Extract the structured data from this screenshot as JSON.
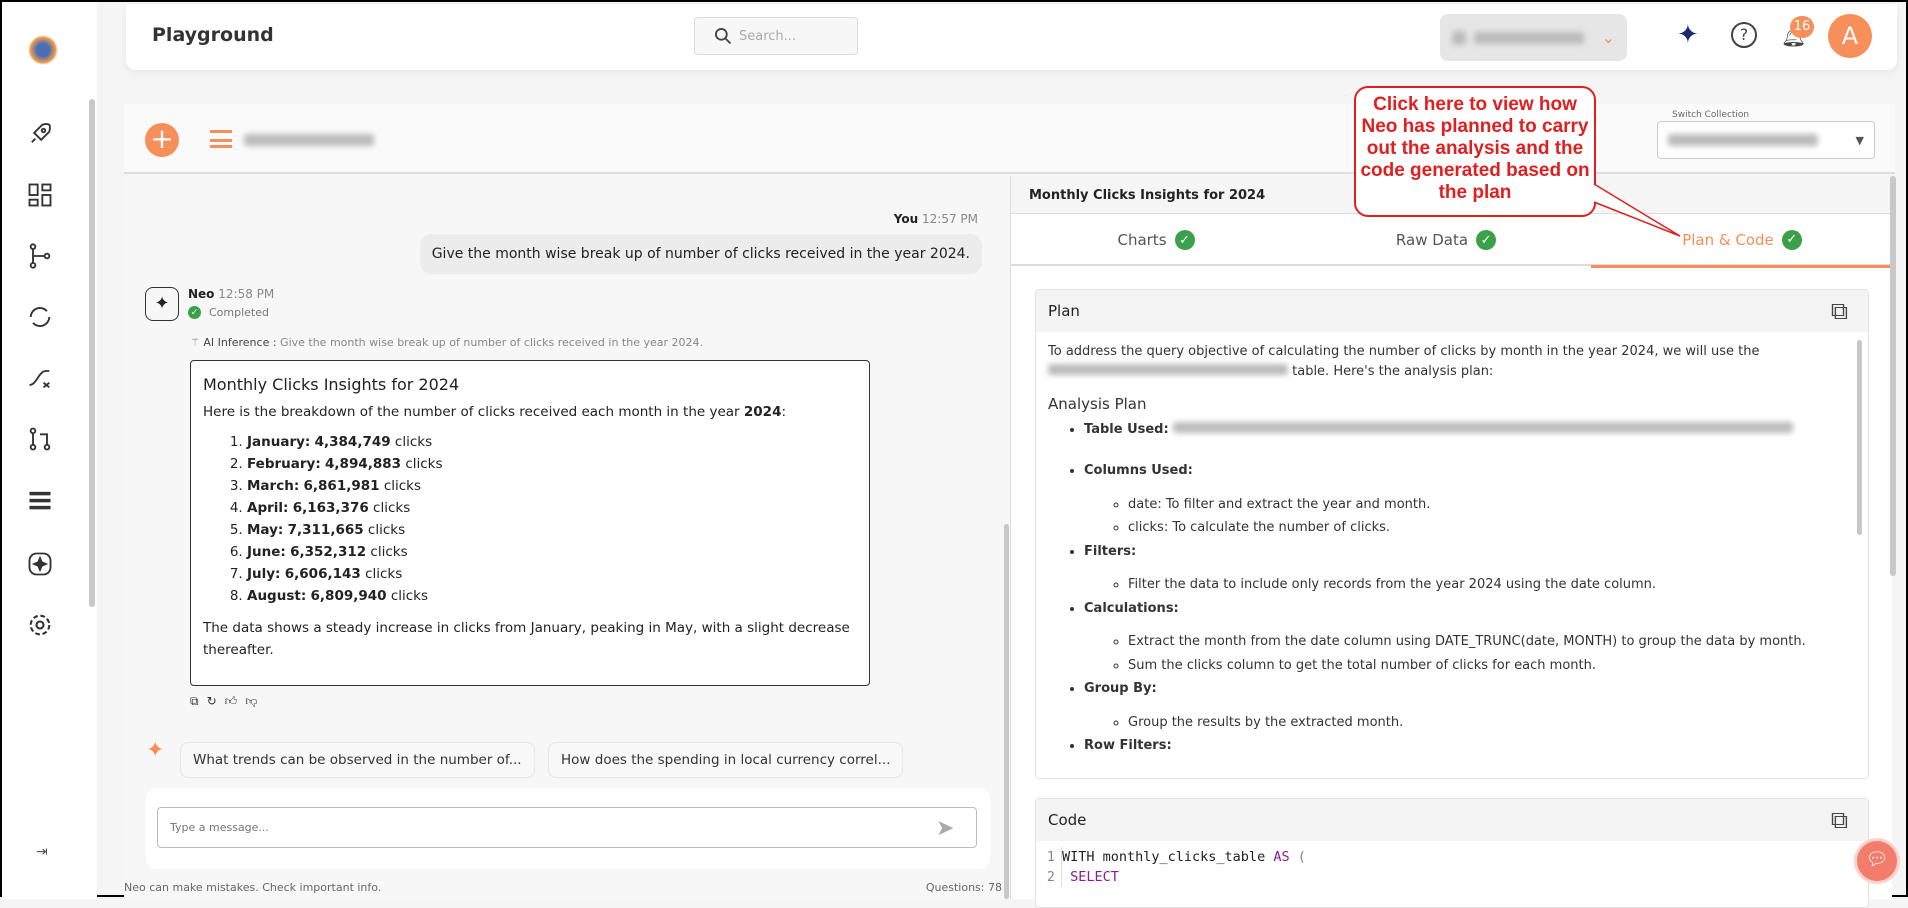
{
  "header": {
    "title": "Playground",
    "search_placeholder": "Search...",
    "notification_count": "16",
    "avatar_letter": "A"
  },
  "toolbar": {
    "switch_collection_label": "Switch Collection"
  },
  "sidebar": {
    "items": [
      "rocket-icon",
      "dashboard-icon",
      "flow-icon",
      "sync-icon",
      "shuffle-icon",
      "pull-request-icon",
      "list-icon",
      "ai-icon",
      "settings-icon"
    ]
  },
  "chat": {
    "user_name": "You",
    "user_time": "12:57 PM",
    "user_message": "Give the month wise break up of number of clicks received in the year 2024.",
    "bot_name": "Neo",
    "bot_time": "12:58 PM",
    "status": "Completed",
    "inference_label": "AI Inference :",
    "inference_text": " Give the month wise break up of number of clicks received in the year 2024.",
    "response": {
      "title": "Monthly Clicks Insights for 2024",
      "intro": "Here is the breakdown of the number of clicks received each month in the year ",
      "intro_bold": "2024",
      "intro_end": ":",
      "items": [
        {
          "month": "January:",
          "value": "4,384,749",
          "unit": " clicks"
        },
        {
          "month": "February:",
          "value": "4,894,883",
          "unit": " clicks"
        },
        {
          "month": "March:",
          "value": "6,861,981",
          "unit": " clicks"
        },
        {
          "month": "April:",
          "value": "6,163,376",
          "unit": " clicks"
        },
        {
          "month": "May:",
          "value": "7,311,665",
          "unit": " clicks"
        },
        {
          "month": "June:",
          "value": "6,352,312",
          "unit": " clicks"
        },
        {
          "month": "July:",
          "value": "6,606,143",
          "unit": " clicks"
        },
        {
          "month": "August:",
          "value": "6,809,940",
          "unit": " clicks"
        }
      ],
      "summary": "The data shows a steady increase in clicks from January, peaking in May, with a slight decrease thereafter."
    },
    "suggestions": [
      "What trends can be observed in the number of...",
      "How does the spending in local currency correl..."
    ],
    "input_placeholder": "Type a message...",
    "disclaimer": "Neo can make mistakes. Check important info.",
    "questions": "Questions: 78"
  },
  "right": {
    "title": "Monthly Clicks Insights for 2024",
    "tabs": [
      {
        "label": "Charts"
      },
      {
        "label": "Raw Data"
      },
      {
        "label": "Plan & Code",
        "active": true
      }
    ],
    "plan": {
      "heading": "Plan",
      "intro1": "To address the query objective of calculating the number of clicks by month in the year 2024, we will use the",
      "intro2": " table. Here's the analysis plan:",
      "analysis_heading": "Analysis Plan",
      "table_used": "Table Used:",
      "columns_used": "Columns Used:",
      "col_date": "date: To filter and extract the year and month.",
      "col_clicks": "clicks: To calculate the number of clicks.",
      "filters": "Filters:",
      "filter1": "Filter the data to include only records from the year 2024 using the date column.",
      "calculations": "Calculations:",
      "calc1": "Extract the month from the date column using DATE_TRUNC(date, MONTH) to group the data by month.",
      "calc2": "Sum the clicks column to get the total number of clicks for each month.",
      "group_by": "Group By:",
      "group1": "Group the results by the extracted month.",
      "row_filters": "Row Filters:"
    },
    "code": {
      "heading": "Code",
      "lines": [
        {
          "n": "1",
          "a": "WITH monthly_clicks_table ",
          "k": "AS",
          "b": " ("
        },
        {
          "n": "2",
          "a": " ",
          "k": "SELECT",
          "b": ""
        }
      ]
    }
  },
  "callout": {
    "text": "Click here to view how Neo has planned to carry out the analysis and the code generated based on the plan"
  },
  "colors": {
    "accent": "#f78f5a",
    "success": "#3aa14a",
    "callout": "#e02020",
    "keyword": "#8b1a9b"
  }
}
